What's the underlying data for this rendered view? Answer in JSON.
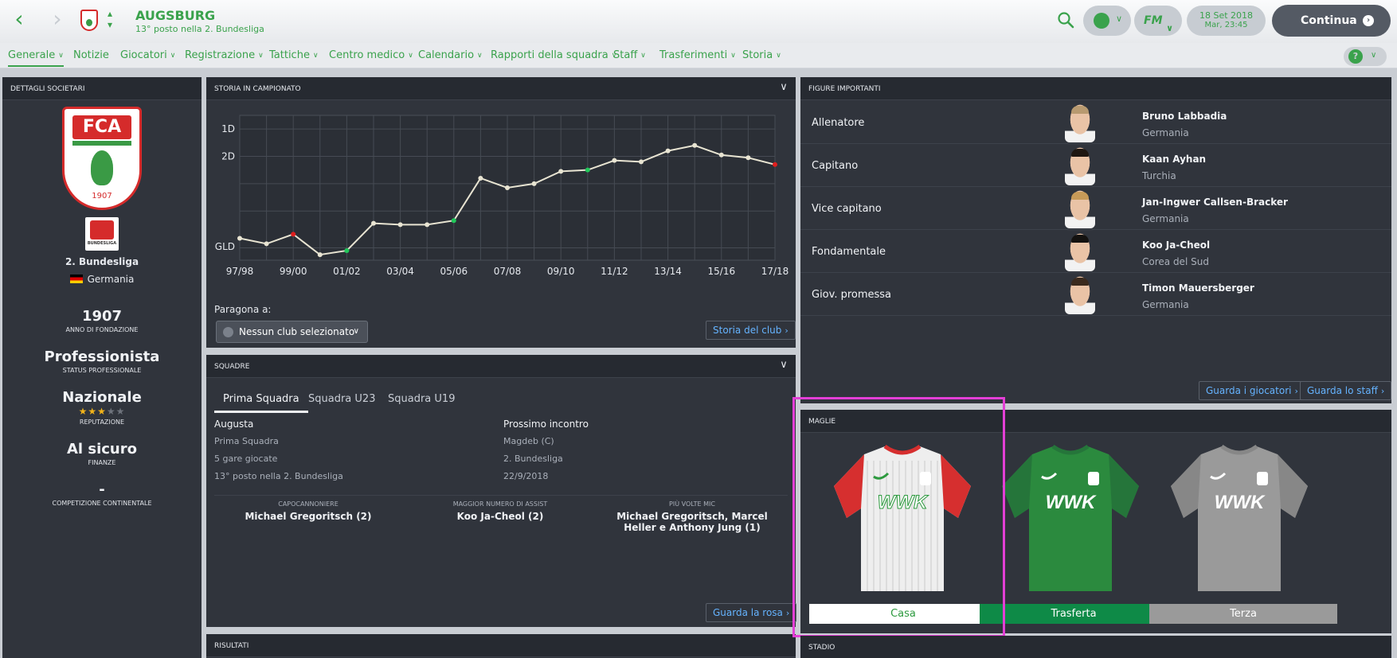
{
  "header": {
    "club_name": "AUGSBURG",
    "club_subtitle": "13° posto nella 2. Bundesliga",
    "date_line1": "18 Set 2018",
    "date_line2": "Mar, 23:45",
    "fm_label": "FM",
    "continue_label": "Continua"
  },
  "menu": {
    "items": [
      "Generale",
      "Notizie",
      "Giocatori",
      "Registrazione",
      "Tattiche",
      "Centro medico",
      "Calendario",
      "Rapporti della squadra",
      "Staff",
      "Trasferimenti",
      "Storia"
    ],
    "help": "?"
  },
  "club_details": {
    "title": "DETTAGLI SOCIETARI",
    "crest_text": "FCA",
    "crest_year": "1907",
    "league_logo_text": "BUNDESLIGA",
    "league": "2. Bundesliga",
    "country": "Germania",
    "founded": "1907",
    "founded_label": "ANNO DI FONDAZIONE",
    "status": "Professionista",
    "status_label": "STATUS PROFESSIONALE",
    "reputation": "Nazionale",
    "reputation_stars": 3,
    "reputation_label": "REPUTAZIONE",
    "finances": "Al sicuro",
    "finances_label": "FINANZE",
    "continental": "-",
    "continental_label": "COMPETIZIONE CONTINENTALE"
  },
  "storia": {
    "title": "STORIA IN CAMPIONATO",
    "compare_label": "Paragona a:",
    "compare_value": "Nessun club selezionato",
    "history_button": "Storia del club"
  },
  "chart_data": {
    "type": "line",
    "x": [
      "97/98",
      "98/99",
      "99/00",
      "00/01",
      "01/02",
      "02/03",
      "03/04",
      "04/05",
      "05/06",
      "06/07",
      "07/08",
      "08/09",
      "09/10",
      "10/11",
      "11/12",
      "12/13",
      "13/14",
      "14/15",
      "15/16",
      "16/17",
      "17/18"
    ],
    "x_tick_labels": [
      "97/98",
      "99/00",
      "01/02",
      "03/04",
      "05/06",
      "07/08",
      "09/10",
      "11/12",
      "13/14",
      "15/16",
      "17/18"
    ],
    "y_tick_labels": [
      "1D",
      "2D",
      "GLD"
    ],
    "series": [
      {
        "values": [
          5.0,
          5.2,
          4.85,
          5.6,
          5.45,
          4.45,
          4.5,
          4.5,
          4.35,
          2.8,
          3.15,
          3.0,
          2.55,
          2.5,
          2.15,
          2.2,
          1.8,
          1.6,
          1.95,
          2.05,
          2.3
        ]
      }
    ],
    "promotion_seasons": [
      "01/02",
      "05/06",
      "10/11"
    ],
    "relegation_seasons": [
      "99/00",
      "17/18"
    ],
    "grid": true,
    "colors": {
      "line": "#e8e4d2",
      "promotion": "#21c85a",
      "relegation": "#e01e1e"
    }
  },
  "squadre": {
    "title": "SQUADRE",
    "tabs": [
      "Prima Squadra",
      "Squadra U23",
      "Squadra U19"
    ],
    "team_name": "Augusta",
    "team_type": "Prima Squadra",
    "games": "5 gare giocate",
    "position": "13° posto nella 2. Bundesliga",
    "next_label": "Prossimo incontro",
    "next_opponent": "Magdeb (C)",
    "next_competition": "2. Bundesliga",
    "next_date": "22/9/2018",
    "stats": [
      {
        "label": "CAPOCANNONIERE",
        "value": "Michael Gregoritsch (2)"
      },
      {
        "label": "MAGGIOR NUMERO DI ASSIST",
        "value": "Koo Ja-Cheol (2)"
      },
      {
        "label": "PIÙ VOLTE MIC",
        "value": "Michael Gregoritsch, Marcel Heller e Anthony Jung (1)"
      }
    ],
    "roster_button": "Guarda la rosa"
  },
  "risultati": {
    "title": "RISULTATI"
  },
  "figure": {
    "title": "FIGURE IMPORTANTI",
    "rows": [
      {
        "role": "Allenatore",
        "name": "Bruno Labbadia",
        "nation": "Germania",
        "hair": "#b89a70"
      },
      {
        "role": "Capitano",
        "name": "Kaan Ayhan",
        "nation": "Turchia",
        "hair": "#1e1712"
      },
      {
        "role": "Vice capitano",
        "name": "Jan-Ingwer Callsen-Bracker",
        "nation": "Germania",
        "hair": "#c79a58"
      },
      {
        "role": "Fondamentale",
        "name": "Koo Ja-Cheol",
        "nation": "Corea del Sud",
        "hair": "#141210"
      },
      {
        "role": "Giov. promessa",
        "name": "Timon Mauersberger",
        "nation": "Germania",
        "hair": "#3a2a1e"
      }
    ],
    "players_button": "Guarda i giocatori",
    "staff_button": "Guarda lo staff"
  },
  "maglie": {
    "title": "MAGLIE",
    "kits": [
      {
        "label": "Casa",
        "sponsor": "WWK",
        "body": "#eeeeee",
        "sleeve": "#d62f2f",
        "label_bg": "#ffffff",
        "label_color": "#2d9a3f"
      },
      {
        "label": "Trasferta",
        "sponsor": "WWK",
        "body": "#2b8a3e",
        "sleeve": "#25753a",
        "label_bg": "#0e8a47",
        "label_color": "#ffffff"
      },
      {
        "label": "Terza",
        "sponsor": "WWK",
        "body": "#9a9a9a",
        "sleeve": "#878787",
        "label_bg": "#9a9a9a",
        "label_color": "#ffffff"
      }
    ]
  },
  "stadio": {
    "title": "STADIO"
  }
}
